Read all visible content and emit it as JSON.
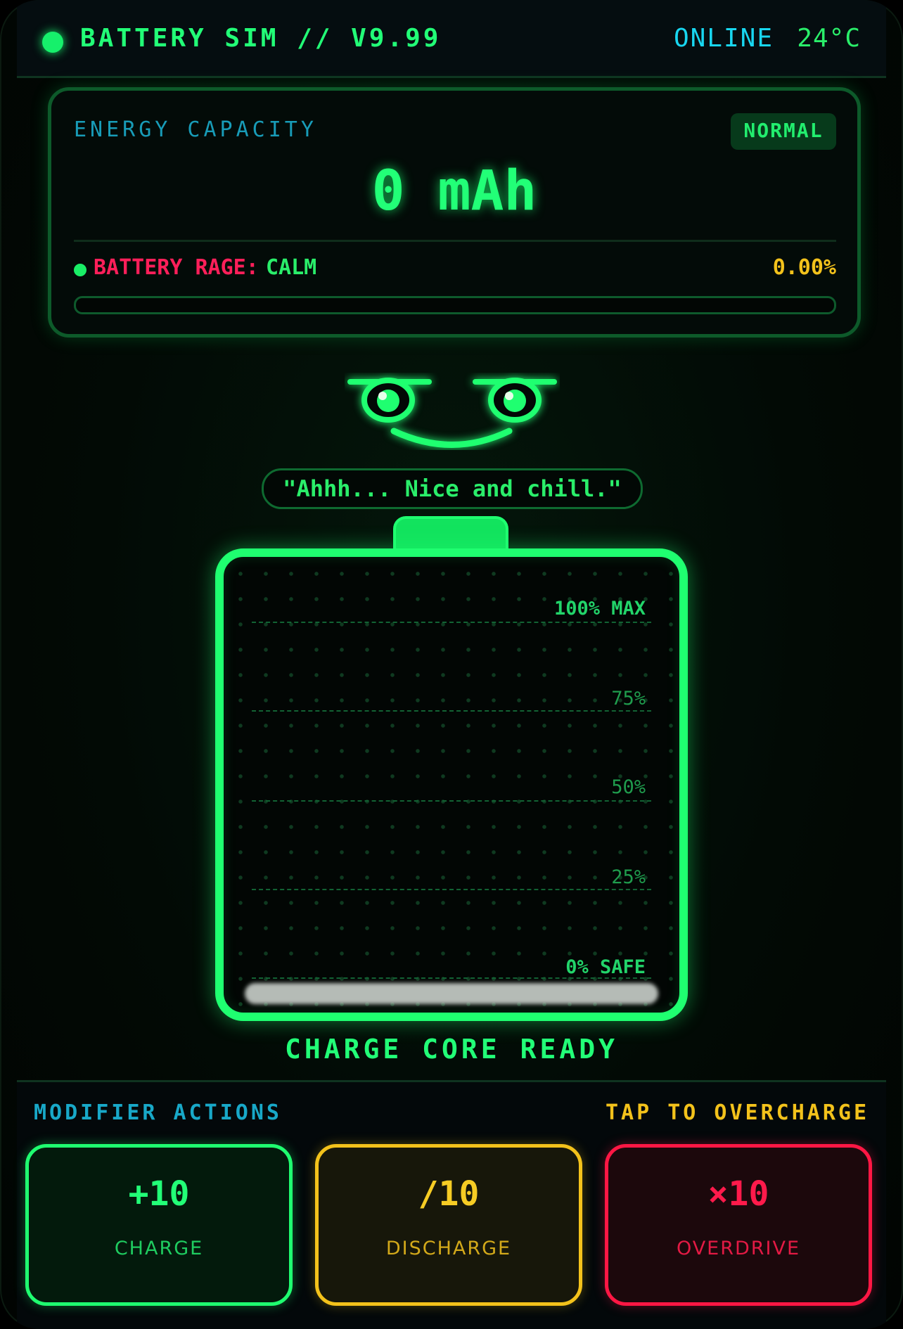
{
  "header": {
    "title": "BATTERY SIM // V9.99",
    "status": "ONLINE",
    "temperature": "24°C"
  },
  "capacity_panel": {
    "label": "ENERGY CAPACITY",
    "mode_badge": "NORMAL",
    "value": "0 mAh",
    "rage_label": "BATTERY RAGE:",
    "rage_state": "CALM",
    "rage_percent_text": "0.00%",
    "rage_fraction": 0.0
  },
  "mascot": {
    "quote": "\"Ahhh... Nice and chill.\""
  },
  "battery": {
    "levels": [
      "100% MAX",
      "75%",
      "50%",
      "25%",
      "0% SAFE"
    ],
    "charge_fraction": 0.0,
    "status": "CHARGE CORE READY"
  },
  "actions": {
    "left_label": "MODIFIER ACTIONS",
    "right_label": "TAP TO OVERCHARGE",
    "buttons": [
      {
        "value": "+10",
        "name": "CHARGE"
      },
      {
        "value": "/10",
        "name": "DISCHARGE"
      },
      {
        "value": "×10",
        "name": "OVERDRIVE"
      }
    ]
  },
  "colors": {
    "accent_green": "#22ff77",
    "accent_cyan": "#18d6f0",
    "warn_yellow": "#f3c21b",
    "danger_red": "#ff1744"
  }
}
